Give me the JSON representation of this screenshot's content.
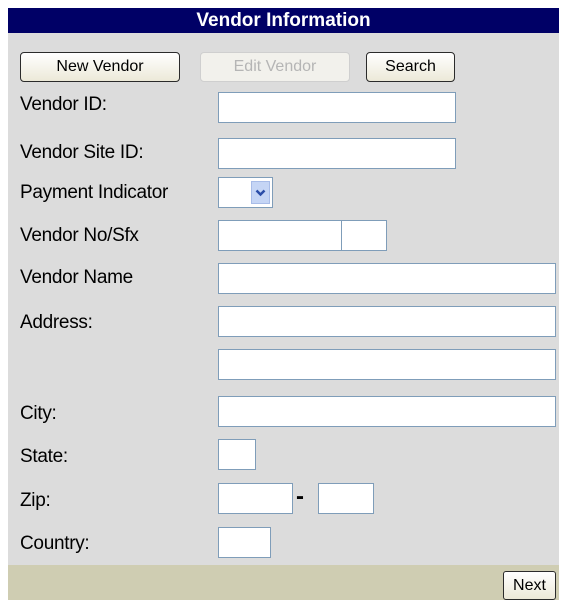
{
  "title": "Vendor Information",
  "toolbar": {
    "new_vendor": "New Vendor",
    "edit_vendor": "Edit Vendor",
    "search": "Search"
  },
  "labels": {
    "vendor_id": "Vendor ID:",
    "vendor_site_id": "Vendor Site ID:",
    "payment_indicator": "Payment Indicator",
    "vendor_no_sfx": "Vendor No/Sfx",
    "vendor_name": "Vendor Name",
    "address": "Address:",
    "city": "City:",
    "state": "State:",
    "zip": "Zip:",
    "country": "Country:"
  },
  "zip_separator": "-",
  "footer": {
    "next": "Next"
  },
  "icons": {
    "dropdown_arrow": "chevron-down-icon"
  },
  "colors": {
    "title_bg": "#000066",
    "panel_bg": "#dcdcdc",
    "footer_bg": "#cfcdb2",
    "field_border": "#7f9db9"
  }
}
